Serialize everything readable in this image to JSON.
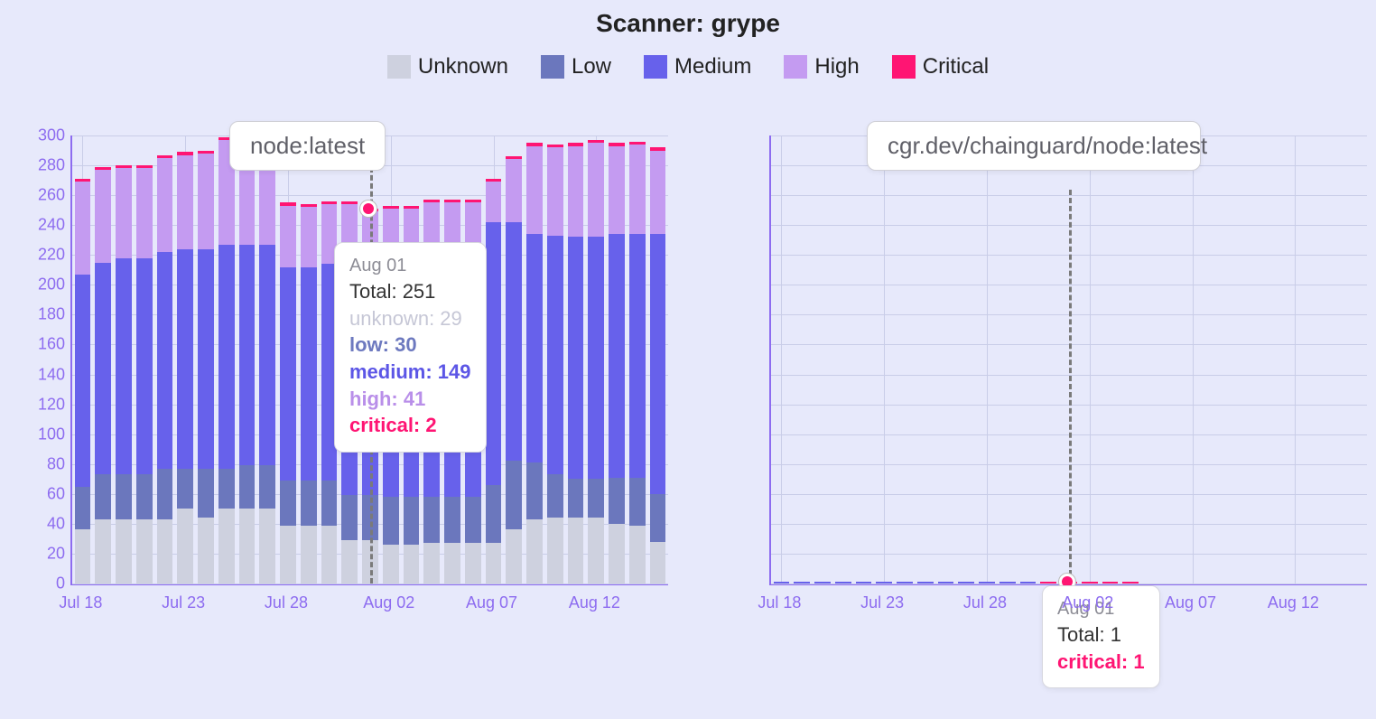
{
  "title": "Scanner: grype",
  "legend": [
    {
      "key": "unknown",
      "label": "Unknown",
      "color": "#ced1df"
    },
    {
      "key": "low",
      "label": "Low",
      "color": "#6b77bd"
    },
    {
      "key": "medium",
      "label": "Medium",
      "color": "#6761eb"
    },
    {
      "key": "high",
      "label": "High",
      "color": "#c49bf1"
    },
    {
      "key": "critical",
      "label": "Critical",
      "color": "#ff1573"
    }
  ],
  "axis": {
    "ymax": 300,
    "yticks": [
      0,
      20,
      40,
      60,
      80,
      100,
      120,
      140,
      160,
      180,
      200,
      220,
      240,
      260,
      280,
      300
    ],
    "xlabels": [
      "Jul 18",
      "Jul 23",
      "Jul 28",
      "Aug 02",
      "Aug 07",
      "Aug 12"
    ]
  },
  "panels": [
    {
      "name": "node:latest"
    },
    {
      "name": "cgr.dev/chainguard/node:latest"
    }
  ],
  "tooltip_left": {
    "date": "Aug 01",
    "total": "Total: 251",
    "unknown": "unknown: 29",
    "low": "low: 30",
    "medium": "medium: 149",
    "high": "high: 41",
    "critical": "critical: 2"
  },
  "tooltip_right": {
    "date": "Aug 01",
    "total": "Total: 1",
    "critical": "critical: 1"
  },
  "chart_data": {
    "type": "bar",
    "stacked": true,
    "title": "Scanner: grype",
    "ylabel": "",
    "xlabel": "",
    "ylim": [
      0,
      300
    ],
    "categories": [
      "Jul 18",
      "Jul 19",
      "Jul 20",
      "Jul 21",
      "Jul 22",
      "Jul 23",
      "Jul 24",
      "Jul 25",
      "Jul 26",
      "Jul 27",
      "Jul 28",
      "Jul 29",
      "Jul 30",
      "Jul 31",
      "Aug 01",
      "Aug 02",
      "Aug 03",
      "Aug 04",
      "Aug 05",
      "Aug 06",
      "Aug 07",
      "Aug 08",
      "Aug 09",
      "Aug 10",
      "Aug 11",
      "Aug 12",
      "Aug 13",
      "Aug 14",
      "Aug 15"
    ],
    "panels": [
      {
        "name": "node:latest",
        "series": [
          {
            "name": "Unknown",
            "color": "#ced1df",
            "values": [
              36,
              43,
              43,
              43,
              43,
              50,
              44,
              50,
              50,
              50,
              39,
              39,
              39,
              29,
              29,
              26,
              26,
              27,
              27,
              27,
              27,
              36,
              43,
              44,
              44,
              44,
              40,
              39,
              28
            ]
          },
          {
            "name": "Low",
            "color": "#6b77bd",
            "values": [
              29,
              30,
              30,
              30,
              34,
              27,
              33,
              27,
              29,
              29,
              30,
              30,
              30,
              30,
              30,
              32,
              32,
              31,
              31,
              31,
              39,
              46,
              38,
              29,
              26,
              26,
              31,
              32,
              32
            ]
          },
          {
            "name": "Medium",
            "color": "#6761eb",
            "values": [
              142,
              142,
              145,
              145,
              145,
              147,
              147,
              150,
              148,
              148,
              143,
              143,
              145,
              149,
              149,
              149,
              149,
              151,
              151,
              151,
              176,
              160,
              153,
              160,
              162,
              162,
              163,
              163,
              174
            ]
          },
          {
            "name": "High",
            "color": "#c49bf1",
            "values": [
              62,
              62,
              60,
              60,
              63,
              63,
              64,
              70,
              70,
              69,
              41,
              40,
              40,
              46,
              41,
              44,
              44,
              46,
              46,
              46,
              27,
              42,
              59,
              59,
              61,
              63,
              59,
              60,
              56
            ]
          },
          {
            "name": "Critical",
            "color": "#ff1573",
            "values": [
              2,
              2,
              2,
              2,
              2,
              2,
              2,
              2,
              2,
              2,
              2,
              2,
              2,
              2,
              2,
              2,
              2,
              2,
              2,
              2,
              2,
              2,
              2,
              2,
              2,
              2,
              2,
              2,
              2
            ]
          }
        ],
        "highlight": {
          "date": "Aug 01",
          "total": 251,
          "unknown": 29,
          "low": 30,
          "medium": 149,
          "high": 41,
          "critical": 2
        }
      },
      {
        "name": "cgr.dev/chainguard/node:latest",
        "series": [
          {
            "name": "Unknown",
            "color": "#ced1df",
            "values": [
              0,
              0,
              0,
              0,
              0,
              0,
              0,
              0,
              0,
              0,
              0,
              0,
              0,
              0,
              0,
              0,
              0,
              0,
              0,
              0,
              0,
              0,
              0,
              0,
              0,
              0,
              0,
              0,
              0
            ]
          },
          {
            "name": "Low",
            "color": "#6b77bd",
            "values": [
              0,
              0,
              0,
              0,
              0,
              0,
              0,
              0,
              0,
              0,
              0,
              0,
              0,
              0,
              0,
              0,
              0,
              0,
              0,
              0,
              0,
              0,
              0,
              0,
              0,
              0,
              0,
              0,
              0
            ]
          },
          {
            "name": "Medium",
            "color": "#6761eb",
            "values": [
              1,
              1,
              1,
              1,
              1,
              1,
              1,
              1,
              1,
              1,
              1,
              1,
              1,
              0,
              0,
              0,
              0,
              0,
              0,
              0,
              0,
              0,
              0,
              0,
              0,
              0,
              0,
              0,
              0
            ]
          },
          {
            "name": "High",
            "color": "#c49bf1",
            "values": [
              0,
              0,
              0,
              0,
              0,
              0,
              0,
              0,
              0,
              0,
              0,
              0,
              0,
              0,
              0,
              0,
              0,
              0,
              0,
              0,
              0,
              0,
              0,
              0,
              0,
              0,
              0,
              0,
              0
            ]
          },
          {
            "name": "Critical",
            "color": "#ff1573",
            "values": [
              0,
              0,
              0,
              0,
              0,
              0,
              0,
              0,
              0,
              0,
              0,
              0,
              0,
              1,
              1,
              1,
              1,
              1,
              0,
              0,
              0,
              0,
              0,
              0,
              0,
              0,
              0,
              0,
              0
            ]
          }
        ],
        "highlight": {
          "date": "Aug 01",
          "total": 1,
          "critical": 1
        }
      }
    ]
  }
}
